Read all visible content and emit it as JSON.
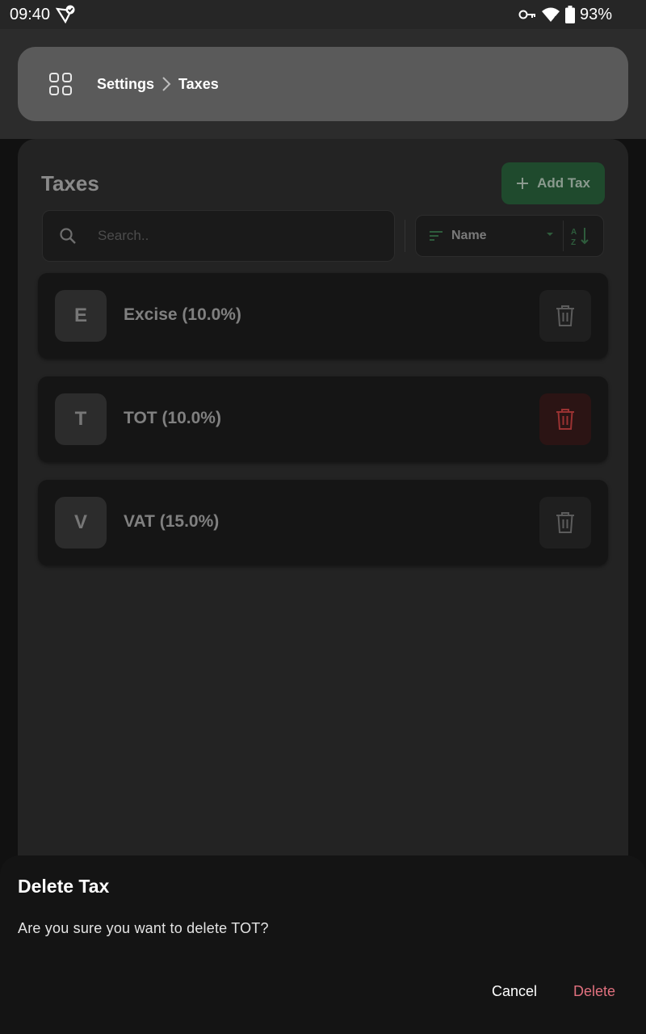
{
  "status_bar": {
    "time": "09:40",
    "battery": "93%"
  },
  "breadcrumb": {
    "root": "Settings",
    "current": "Taxes"
  },
  "panel": {
    "title": "Taxes",
    "add_button": "Add Tax"
  },
  "search": {
    "placeholder": "Search.."
  },
  "sort": {
    "label": "Name"
  },
  "taxes": [
    {
      "initial": "E",
      "label": "Excise (10.0%)"
    },
    {
      "initial": "T",
      "label": "TOT (10.0%)"
    },
    {
      "initial": "V",
      "label": "VAT (15.0%)"
    }
  ],
  "dialog": {
    "title": "Delete Tax",
    "message": "Are you sure you want to delete TOT?",
    "cancel": "Cancel",
    "delete": "Delete"
  },
  "colors": {
    "accent_green": "#1f4a2d",
    "danger": "#e0707e",
    "trash_active": "#9a3232"
  }
}
